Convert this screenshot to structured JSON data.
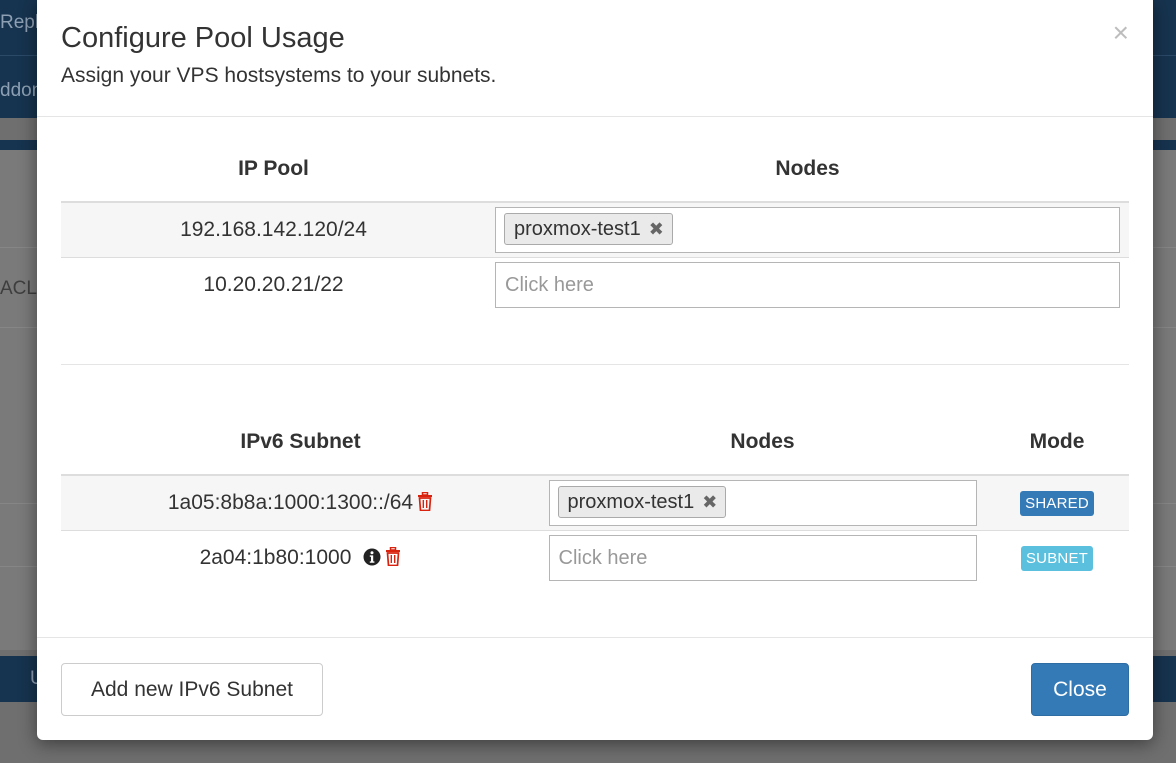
{
  "background": {
    "text_reply": "Reply",
    "text_addon": "ddon",
    "text_acl": "ACL",
    "text_u": "U"
  },
  "modal": {
    "title": "Configure Pool Usage",
    "subtitle": "Assign your VPS hostsystems to your subnets.",
    "close_symbol": "×"
  },
  "ip_pool_table": {
    "headers": {
      "pool": "IP Pool",
      "nodes": "Nodes"
    },
    "rows": [
      {
        "pool": "192.168.142.120/24",
        "tags": [
          "proxmox-test1"
        ],
        "placeholder": ""
      },
      {
        "pool": "10.20.20.21/22",
        "tags": [],
        "placeholder": "Click here"
      }
    ]
  },
  "ipv6_table": {
    "headers": {
      "subnet": "IPv6 Subnet",
      "nodes": "Nodes",
      "mode": "Mode"
    },
    "rows": [
      {
        "subnet": "1a05:8b8a:1000:1300::/64",
        "tags": [
          "proxmox-test1"
        ],
        "placeholder": "",
        "mode": "SHARED"
      },
      {
        "subnet": "2a04:1b80:1000",
        "tags": [],
        "placeholder": "Click here",
        "mode": "SUBNET"
      }
    ]
  },
  "tag_remove_symbol": "✖",
  "footer": {
    "add_button": "Add new IPv6 Subnet",
    "close_button": "Close"
  },
  "colors": {
    "primary": "#337ab7",
    "info": "#5bc0de",
    "danger": "#d9230f"
  },
  "icons": {
    "trash": "trash-icon",
    "info": "info-circle-icon",
    "remove": "remove-tag-icon",
    "close": "close-icon"
  }
}
